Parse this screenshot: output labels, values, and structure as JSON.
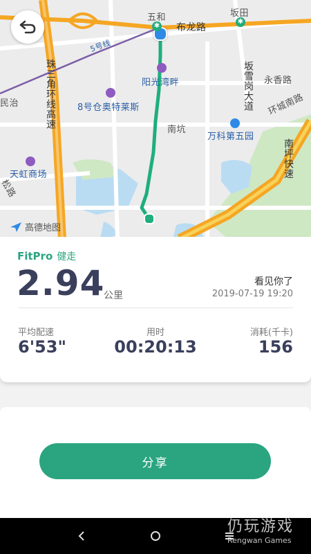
{
  "map": {
    "labels": {
      "wuhe": "五和",
      "bulong_road": "布龙路",
      "bantian": "坂田",
      "line5": "5号线",
      "zhusan_highway": "珠三角环线高速",
      "bansuegang": "坂雪岗大道",
      "yongxiang_road": "永香路",
      "minzhi": "民治",
      "yangguang_wanpan": "阳光湾畔",
      "outlet": "8号仓奥特莱斯",
      "nankeng": "南坑",
      "huancheng_south": "环城南路",
      "vanke_5": "万科第五园",
      "nanping_express": "南坪快速",
      "tianhong": "天虹商场",
      "songluo": "松路",
      "logo_text": "高德地图"
    }
  },
  "header": {
    "back_icon": "back-arrow-icon"
  },
  "summary": {
    "brand": "FitPro",
    "activity": "健走",
    "distance": "2.94",
    "distance_unit": "公里",
    "greeting": "看见你了",
    "datetime": "2019-07-19 19:20",
    "stats": [
      {
        "label": "平均配速",
        "value": "6'53\""
      },
      {
        "label": "用时",
        "value": "00:20:13"
      },
      {
        "label": "消耗(千卡)",
        "value": "156"
      }
    ]
  },
  "actions": {
    "share_label": "分享"
  },
  "watermark": {
    "title": "仍玩游戏",
    "sub": "Rengwan Games"
  },
  "colors": {
    "accent": "#2aa57f",
    "route": "#1fae7d",
    "highway": "#f5a623",
    "metro": "#7b5ea7"
  }
}
